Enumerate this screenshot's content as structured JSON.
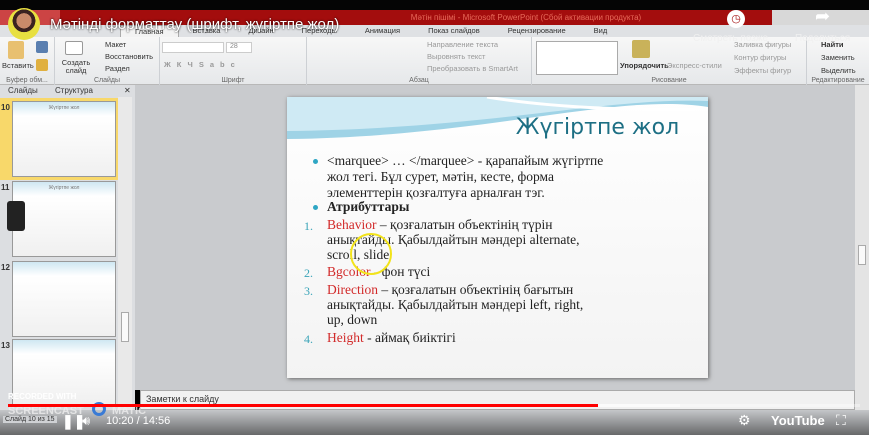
{
  "window": {
    "title": "Мәтін пішімі - Microsoft PowerPoint (Сбой активации продукта)"
  },
  "video": {
    "title": "Мәтінді форматтау (шрифт, жүгіртпе жол)",
    "watch_later": "Смотреть позже",
    "share": "Поделиться",
    "time": "10:20 / 14:56",
    "progress_fraction": 0.692,
    "watermark_top": "RECORDED WITH",
    "watermark_bottom": "SCREENCAST",
    "watermark_end": "MATIC",
    "youtube": "YouTube"
  },
  "tabs": [
    "Главная",
    "Вставка",
    "Дизайн",
    "Переходы",
    "Анимация",
    "Показ слайдов",
    "Рецензирование",
    "Вид"
  ],
  "ribbon": {
    "clipboard": {
      "label": "Буфер обм...",
      "paste": "Вставить"
    },
    "slides": {
      "label": "Слайды",
      "new": "Создать слайд",
      "layout": "Макет",
      "reset": "Восстановить",
      "section": "Раздел"
    },
    "font": {
      "label": "Шрифт",
      "size": "28"
    },
    "paragraph": {
      "label": "Абзац",
      "dir": "Направление текста",
      "align": "Выровнять текст",
      "smartart": "Преобразовать в SmartArt"
    },
    "drawing": {
      "label": "Рисование",
      "arrange": "Упорядочить",
      "quick": "Экспресс-стили",
      "fill": "Заливка фигуры",
      "outline": "Контур фигуры",
      "effects": "Эффекты фигур"
    },
    "editing": {
      "label": "Редактирование",
      "find": "Найти",
      "replace": "Заменить",
      "select": "Выделить"
    }
  },
  "pane": {
    "tabs": [
      "Слайды",
      "Структура"
    ],
    "slides": [
      {
        "num": "10",
        "title": "Жүгіртпе жол"
      },
      {
        "num": "11",
        "title": "Жүгіртпе жол"
      },
      {
        "num": "12",
        "title": ""
      },
      {
        "num": "13",
        "title": ""
      }
    ]
  },
  "slide": {
    "title": "Жүгіртпе жол",
    "bullet1": [
      "<marquee> … </marquee> - қарапайым жүгіртпе",
      "жол тегі. Бұл сурет, мәтін, кесте, форма",
      "элементтерін қозғалтуға арналған тэг."
    ],
    "bullet2": "Атрибуттары",
    "items": [
      {
        "n": "1.",
        "key": "Behavior",
        "lines": [
          " – қозғалатын объектінің түрін",
          "анықтайды.  Қабылдайтын мәндері  alternate,",
          "scroll, slide"
        ]
      },
      {
        "n": "2.",
        "key": "Bgcolor",
        "lines": [
          " - фон түсі"
        ]
      },
      {
        "n": "3.",
        "key": "Direction",
        "lines": [
          " – қозғалатын объектінің бағытын",
          "анықтайды. Қабылдайтын мәндері left, right,",
          "up, down"
        ]
      },
      {
        "n": "4.",
        "key": "Height",
        "lines": [
          " - аймақ биіктігі"
        ]
      }
    ]
  },
  "notes": {
    "placeholder": "Заметки к слайду"
  },
  "status": {
    "slide": "Слайд 10 из 15"
  }
}
